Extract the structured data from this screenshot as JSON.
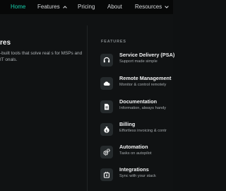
{
  "nav": {
    "items": [
      {
        "label": "Home",
        "active": true
      },
      {
        "label": "Features",
        "has_dropdown": true,
        "dropdown_icon": "chevron-up-icon"
      },
      {
        "label": "Pricing"
      },
      {
        "label": "About"
      },
      {
        "label": "Resources",
        "has_dropdown": true,
        "dropdown_icon": "chevron-down-icon"
      }
    ]
  },
  "colors": {
    "accent": "#16d1ad",
    "background": "#0f1112",
    "nav_background": "#070808",
    "icon_tile": "#252a2c"
  },
  "intro": {
    "title": "res",
    "body": "-built tools that solve real s for MSPs and IT onals."
  },
  "features": {
    "label": "FEATURES",
    "items": [
      {
        "title": "Service Delivery (PSA)",
        "subtitle": "Support made simple",
        "icon": "headset-icon"
      },
      {
        "title": "Remote Management",
        "subtitle": "Monitor & control remotely",
        "icon": "cloud-icon"
      },
      {
        "title": "Documentation",
        "subtitle": "Information, always handy",
        "icon": "document-icon"
      },
      {
        "title": "Billing",
        "subtitle": "Effortless invoicing & contr",
        "icon": "money-bag-icon"
      },
      {
        "title": "Automation",
        "subtitle": "Tasks on autopilot",
        "icon": "gears-icon"
      },
      {
        "title": "Integrations",
        "subtitle": "Sync with your stack",
        "icon": "plug-icon"
      }
    ]
  }
}
